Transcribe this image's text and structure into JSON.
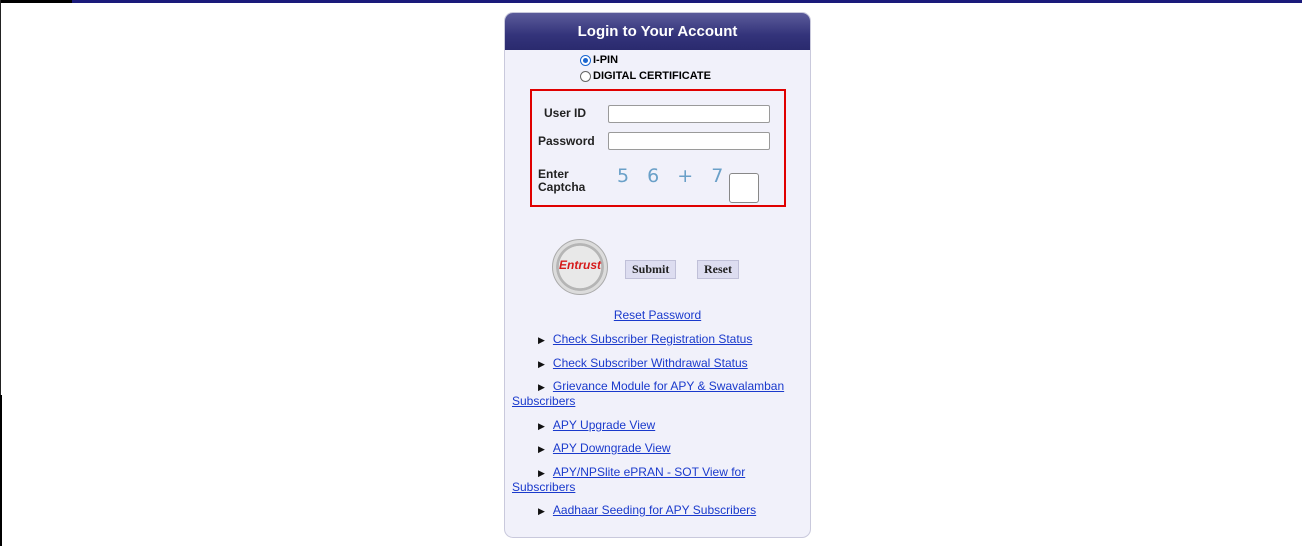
{
  "panel": {
    "title": "Login to Your Account",
    "auth_options": [
      {
        "label": "I-PIN",
        "selected": true
      },
      {
        "label": "DIGITAL CERTIFICATE",
        "selected": false
      }
    ],
    "user_id_label": "User ID",
    "user_id_value": "",
    "password_label": "Password",
    "password_value": "",
    "captcha_label_line1": "Enter",
    "captcha_label_line2": "Captcha",
    "captcha_text": "5 6 + 7 =",
    "captcha_answer": "",
    "seal_text": "Entrust",
    "submit_label": "Submit",
    "reset_label": "Reset",
    "reset_password_link": "Reset Password",
    "links": [
      {
        "label": "Check Subscriber Registration Status"
      },
      {
        "label": "Check Subscriber Withdrawal Status"
      },
      {
        "label": "Grievance Module for APY & Swavalamban Subscribers"
      },
      {
        "label": "APY Upgrade View"
      },
      {
        "label": "APY Downgrade View"
      },
      {
        "label": "APY/NPSlite ePRAN - SOT View for Subscribers"
      },
      {
        "label": "Aadhaar Seeding for APY Subscribers"
      }
    ]
  },
  "colors": {
    "header": "#33337a",
    "panel_bg": "#f1f1fa",
    "link": "#1a3acc",
    "highlight_box": "#e00000"
  }
}
